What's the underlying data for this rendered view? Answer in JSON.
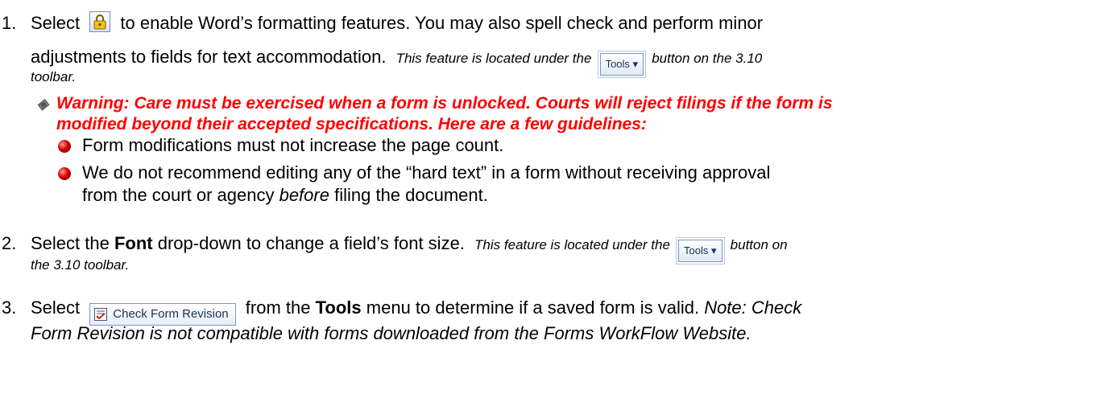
{
  "items": {
    "item1": {
      "number": "1.",
      "select": "Select",
      "text_a": "to enable Word’s formatting features.  You may also spell check and perform minor",
      "text_b": "adjustments to fields for text accommodation.",
      "note_a": "This feature is located under the",
      "note_b": "button on the 3.10",
      "note_c": "toolbar.",
      "lock_icon": "padlock-icon",
      "tools_button_label": "Tools ▾",
      "warning_a": "Warning:  Care must be exercised when a form is unlocked. Courts will reject filings if the form is",
      "warning_b": "modified beyond their accepted specifications. Here are a few guidelines:",
      "bullets": [
        "Form modifications must not increase the page count.",
        "We do not recommend editing any of the “hard text” in a form without receiving approval",
        "from the court or agency",
        "before",
        "filing the document."
      ]
    },
    "item2": {
      "number": "2.",
      "select_the": "Select the",
      "font": "Font",
      "text": "drop-down to change a field’s font size.",
      "note_a": "This feature is located under the",
      "note_b": "button on",
      "note_c": "the 3.10 toolbar.",
      "tools_button_label": "Tools ▾"
    },
    "item3": {
      "number": "3.",
      "select": "Select",
      "check_button_label": "Check Form Revision",
      "from_the": "from the",
      "tools": "Tools",
      "text": "menu to determine if a saved form is valid.",
      "note_a": "Note:  Check",
      "note_b": "Form Revision is not compatible with forms downloaded from the Forms WorkFlow Website."
    }
  },
  "colors": {
    "warning": "#ff0000",
    "bullet": "#d40000"
  }
}
